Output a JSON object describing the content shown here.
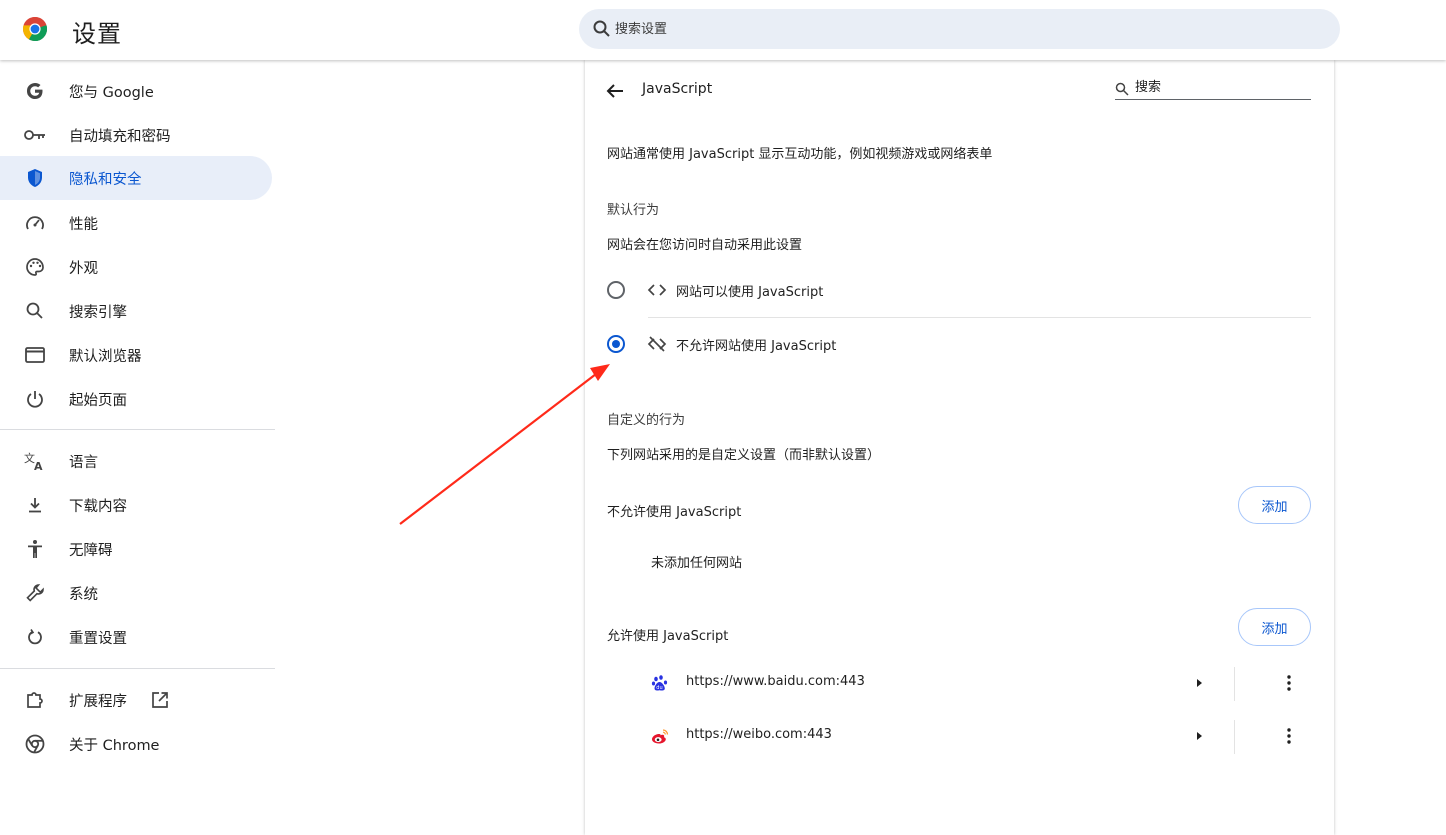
{
  "header": {
    "title": "设置",
    "search_placeholder": "搜索设置"
  },
  "sidebar": {
    "items": [
      {
        "label": "您与 Google",
        "icon": "google-g-icon"
      },
      {
        "label": "自动填充和密码",
        "icon": "key-icon"
      },
      {
        "label": "隐私和安全",
        "icon": "shield-icon",
        "active": true
      },
      {
        "label": "性能",
        "icon": "speedometer-icon"
      },
      {
        "label": "外观",
        "icon": "palette-icon"
      },
      {
        "label": "搜索引擎",
        "icon": "search-icon"
      },
      {
        "label": "默认浏览器",
        "icon": "browser-window-icon"
      },
      {
        "label": "起始页面",
        "icon": "power-icon"
      },
      {
        "label": "语言",
        "icon": "translate-icon"
      },
      {
        "label": "下载内容",
        "icon": "download-icon"
      },
      {
        "label": "无障碍",
        "icon": "accessibility-icon"
      },
      {
        "label": "系统",
        "icon": "wrench-icon"
      },
      {
        "label": "重置设置",
        "icon": "reset-icon"
      },
      {
        "label": "扩展程序",
        "icon": "puzzle-icon"
      },
      {
        "label": "关于 Chrome",
        "icon": "chrome-icon"
      }
    ]
  },
  "main": {
    "title": "JavaScript",
    "search_placeholder": "搜索",
    "description": "网站通常使用 JavaScript 显示互动功能，例如视频游戏或网络表单",
    "default_behavior": {
      "heading": "默认行为",
      "subheading": "网站会在您访问时自动采用此设置",
      "options": [
        {
          "label": "网站可以使用 JavaScript",
          "icon": "code-icon",
          "selected": false
        },
        {
          "label": "不允许网站使用 JavaScript",
          "icon": "code-off-icon",
          "selected": true
        }
      ]
    },
    "custom_behavior": {
      "heading": "自定义的行为",
      "subheading": "下列网站采用的是自定义设置（而非默认设置）"
    },
    "blocked": {
      "heading": "不允许使用 JavaScript",
      "add_label": "添加",
      "empty_text": "未添加任何网站"
    },
    "allowed": {
      "heading": "允许使用 JavaScript",
      "add_label": "添加",
      "sites": [
        {
          "url": "https://www.baidu.com:443",
          "icon": "baidu-paw-icon"
        },
        {
          "url": "https://weibo.com:443",
          "icon": "weibo-icon"
        }
      ]
    }
  },
  "colors": {
    "accent": "#0b57d0",
    "active_bg": "#e8eef9",
    "annotation_arrow": "#ff2a1a"
  }
}
